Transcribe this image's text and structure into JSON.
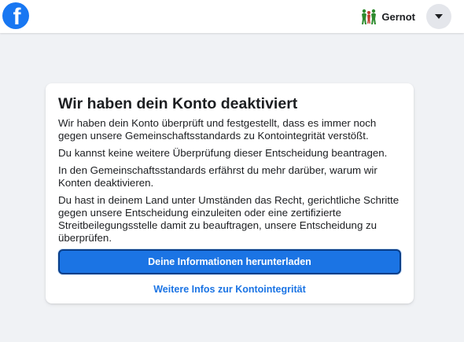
{
  "header": {
    "logo_letter": "f",
    "profile_name": "Gernot",
    "menu_icon": "caret-down-icon"
  },
  "colors": {
    "brand": "#1877f2",
    "button": "#1b74e4",
    "background": "#f0f2f5"
  },
  "card": {
    "title": "Wir haben dein Konto deaktiviert",
    "paragraphs": [
      "Wir haben dein Konto überprüft und festgestellt, dass es immer noch gegen unsere Gemeinschaftsstandards zu Kontointegrität verstößt.",
      "Du kannst keine weitere Überprüfung dieser Entscheidung beantragen.",
      "In den Gemeinschaftsstandards erfährst du mehr darüber, warum wir Konten deaktivieren.",
      "Du hast in deinem Land unter Umständen das Recht, gerichtliche Schritte gegen unsere Entscheidung einzuleiten oder eine zertifizierte Streitbeilegungsstelle damit zu beauftragen, unsere Entscheidung zu überprüfen."
    ],
    "download_label": "Deine Informationen herunterladen",
    "more_link": "Weitere Infos zur Kontointegrität"
  }
}
